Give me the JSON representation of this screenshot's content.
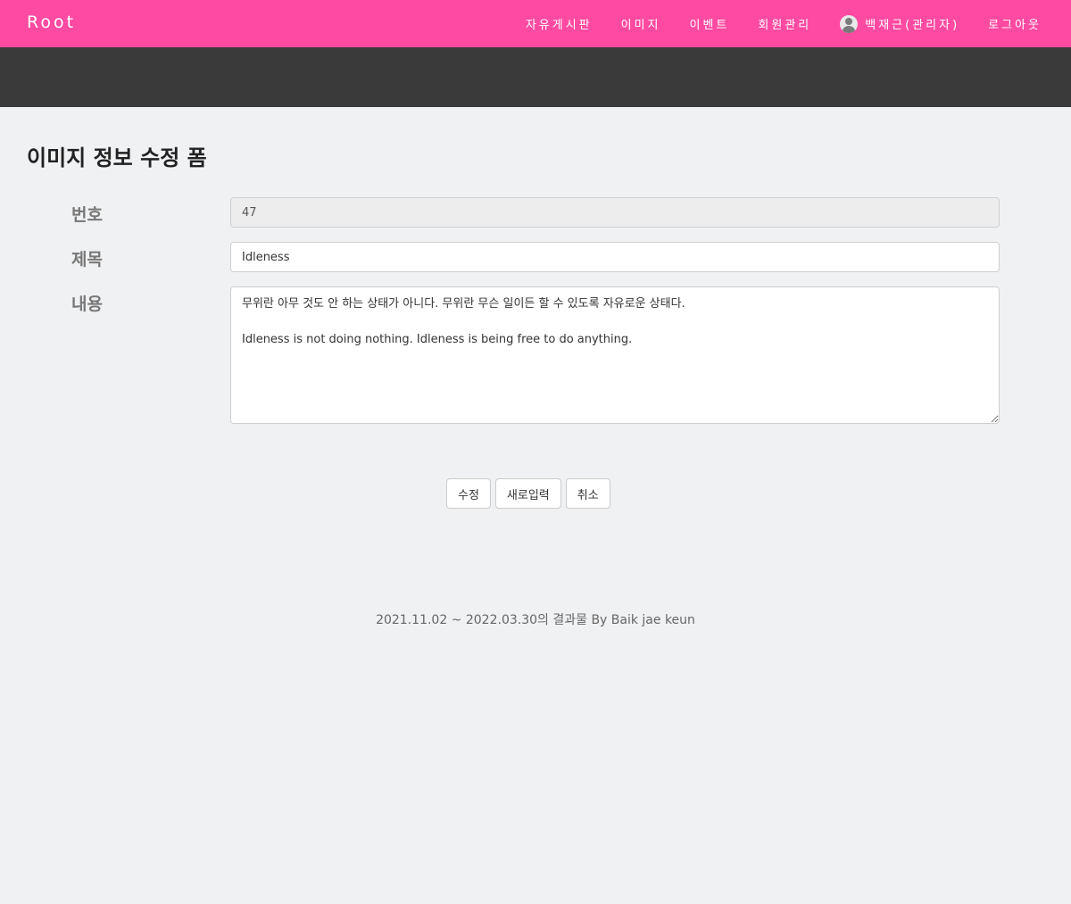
{
  "navbar": {
    "brand": "Root",
    "links": [
      "자유게시판",
      "이미지",
      "이벤트",
      "회원관리"
    ],
    "user_label": "백재근(관리자)",
    "logout": "로그아웃",
    "bg_color": "#ff4aa2"
  },
  "page": {
    "title": "이미지 정보 수정 폼"
  },
  "form": {
    "number_label": "번호",
    "number_value": "47",
    "title_label": "제목",
    "title_value": "Idleness",
    "content_label": "내용",
    "content_value": "무위란 아무 것도 안 하는 상태가 아니다. 무위란 무슨 일이든 할 수 있도록 자유로운 상태다.\n\nIdleness is not doing nothing. Idleness is being free to do anything."
  },
  "buttons": {
    "submit": "수정",
    "reset": "새로입력",
    "cancel": "취소"
  },
  "footer": {
    "text": "2021.11.02 ~ 2022.03.30의 결과물 By Baik jae keun"
  }
}
